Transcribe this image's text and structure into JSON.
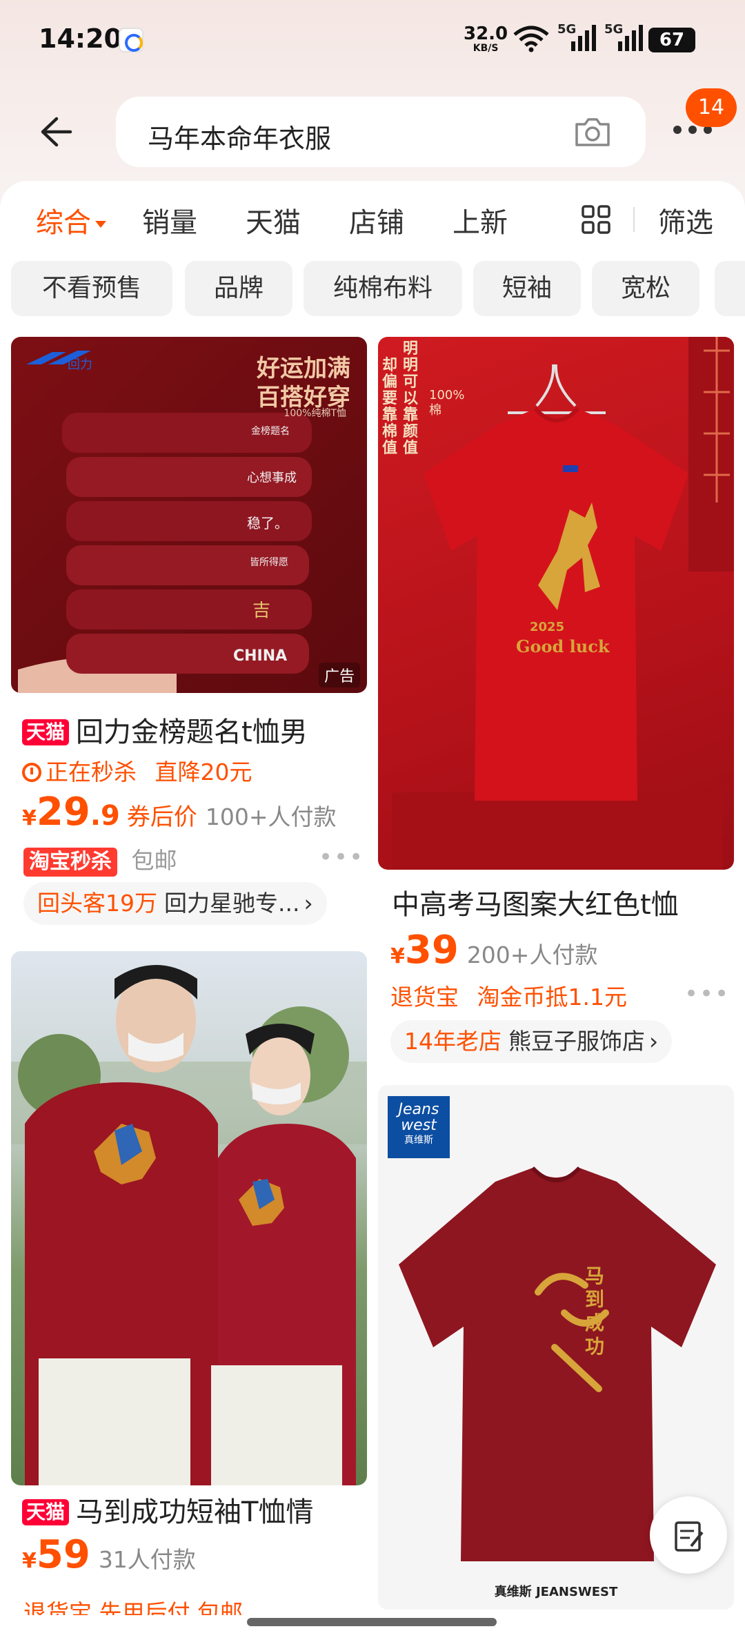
{
  "status": {
    "time": "14:20",
    "net_speed": "32.0",
    "net_unit": "KB/S",
    "battery": "67",
    "sig1": "5G",
    "sig2": "5G"
  },
  "search": {
    "query": "马年本命年衣服"
  },
  "header": {
    "cart_badge": "14"
  },
  "tabs": [
    {
      "label": "综合",
      "active": true
    },
    {
      "label": "销量"
    },
    {
      "label": "天猫"
    },
    {
      "label": "店铺"
    },
    {
      "label": "上新"
    }
  ],
  "filter_label": "筛选",
  "chips": [
    "不看预售",
    "品牌",
    "纯棉布料",
    "短袖",
    "宽松"
  ],
  "products": {
    "p1": {
      "tmall": "天猫",
      "title": "回力金榜题名t恤男",
      "ad": "广告",
      "promo1": "正在秒杀",
      "promo2": "直降20元",
      "yen": "¥",
      "price_int": "29",
      "price_dec": ".9",
      "price_lbl": "券后价",
      "sold": "100+人付款",
      "svc_badge": "淘宝秒杀",
      "svc_free": "包邮",
      "shop_acc": "回头客19万",
      "shop_name": "回力星驰专...",
      "img_brand": "回力",
      "img_slogan1": "好运加满",
      "img_slogan2": "百搭好穿",
      "img_slogan3": "100%纯棉T恤",
      "stack_labels": [
        "金榜题名",
        "心想事成",
        "稳了。",
        "皆所得愿",
        "吉",
        "CHINA"
      ]
    },
    "p2": {
      "title": "中高考马图案大红色t恤",
      "yen": "¥",
      "price_int": "39",
      "sold": "200+人付款",
      "svc1": "退货宝",
      "svc2": "淘金币抵1.1元",
      "shop_acc": "14年老店",
      "shop_name": "熊豆子服饰店",
      "img_v1": "明明可以靠颜值",
      "img_v2": "却偏要靠棉值",
      "img_v3": "100%棉",
      "img_year": "2025",
      "img_luck": "Good luck"
    },
    "p3": {
      "tmall": "天猫",
      "title": "马到成功短袖T恤情",
      "yen": "¥",
      "price_int": "59",
      "sold": "31人付款",
      "svc_partial": "退货宝  先用后付  包邮"
    },
    "p4": {
      "logo1": "Jeans",
      "logo2": "west",
      "logo3": "真维斯",
      "footer": "真维斯 JEANSWEST",
      "calligraphy": "马到成功"
    }
  },
  "colors": {
    "accent": "#ff5000",
    "tmall": "#ff0036",
    "shirt_red": "#c8131b",
    "shirt_burgundy": "#8e1620"
  }
}
